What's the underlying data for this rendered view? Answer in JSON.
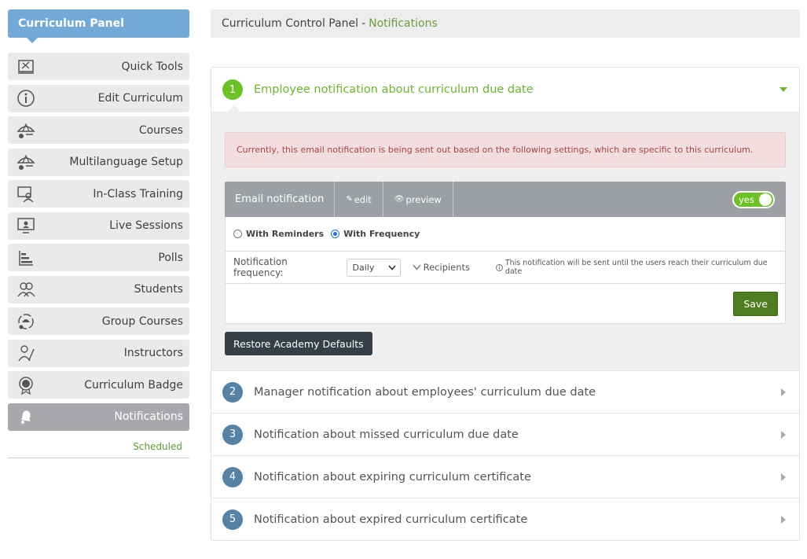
{
  "sidebar": {
    "title": "Curriculum Panel",
    "items": [
      {
        "label": "Quick Tools",
        "icon": "quick-tools-icon"
      },
      {
        "label": "Edit Curriculum",
        "icon": "info-icon"
      },
      {
        "label": "Courses",
        "icon": "courses-icon"
      },
      {
        "label": "Multilanguage Setup",
        "icon": "multilanguage-icon"
      },
      {
        "label": "In-Class Training",
        "icon": "classroom-icon"
      },
      {
        "label": "Live Sessions",
        "icon": "live-session-icon"
      },
      {
        "label": "Polls",
        "icon": "polls-icon"
      },
      {
        "label": "Students",
        "icon": "students-icon"
      },
      {
        "label": "Group Courses",
        "icon": "group-courses-icon"
      },
      {
        "label": "Instructors",
        "icon": "instructor-icon"
      },
      {
        "label": "Curriculum Badge",
        "icon": "badge-icon"
      },
      {
        "label": "Notifications",
        "icon": "bell-icon"
      }
    ],
    "sub_link": "Scheduled"
  },
  "breadcrumb": {
    "root": "Curriculum Control Panel",
    "separator": "-",
    "current": "Notifications"
  },
  "accordion": [
    {
      "number": "1",
      "title": "Employee notification about curriculum due date"
    },
    {
      "number": "2",
      "title": "Manager notification about employees' curriculum due date"
    },
    {
      "number": "3",
      "title": "Notification about missed curriculum due date"
    },
    {
      "number": "4",
      "title": "Notification about expiring curriculum certificate"
    },
    {
      "number": "5",
      "title": "Notification about expired curriculum certificate"
    }
  ],
  "alert_text": "Currently, this email notification is being sent out based on the following settings, which are specific to this curriculum.",
  "notification_bar": {
    "label": "Email notification",
    "edit": "edit",
    "preview": "preview",
    "toggle": "yes"
  },
  "radios": {
    "with_reminders": "With Reminders",
    "with_frequency": "With Frequency",
    "selected": "With Frequency"
  },
  "frequency": {
    "label": "Notification frequency:",
    "value": "Daily",
    "recipients": "Recipients",
    "hint": "This notification will be sent until the users reach their curriculum due date"
  },
  "buttons": {
    "save": "Save",
    "restore": "Restore Academy Defaults"
  },
  "colors": {
    "panel_head": "#73a9d6",
    "accent_green": "#6cc127",
    "save_green": "#4e7d1f",
    "number_blue": "#5582a5",
    "restore_dark": "#353f48"
  }
}
